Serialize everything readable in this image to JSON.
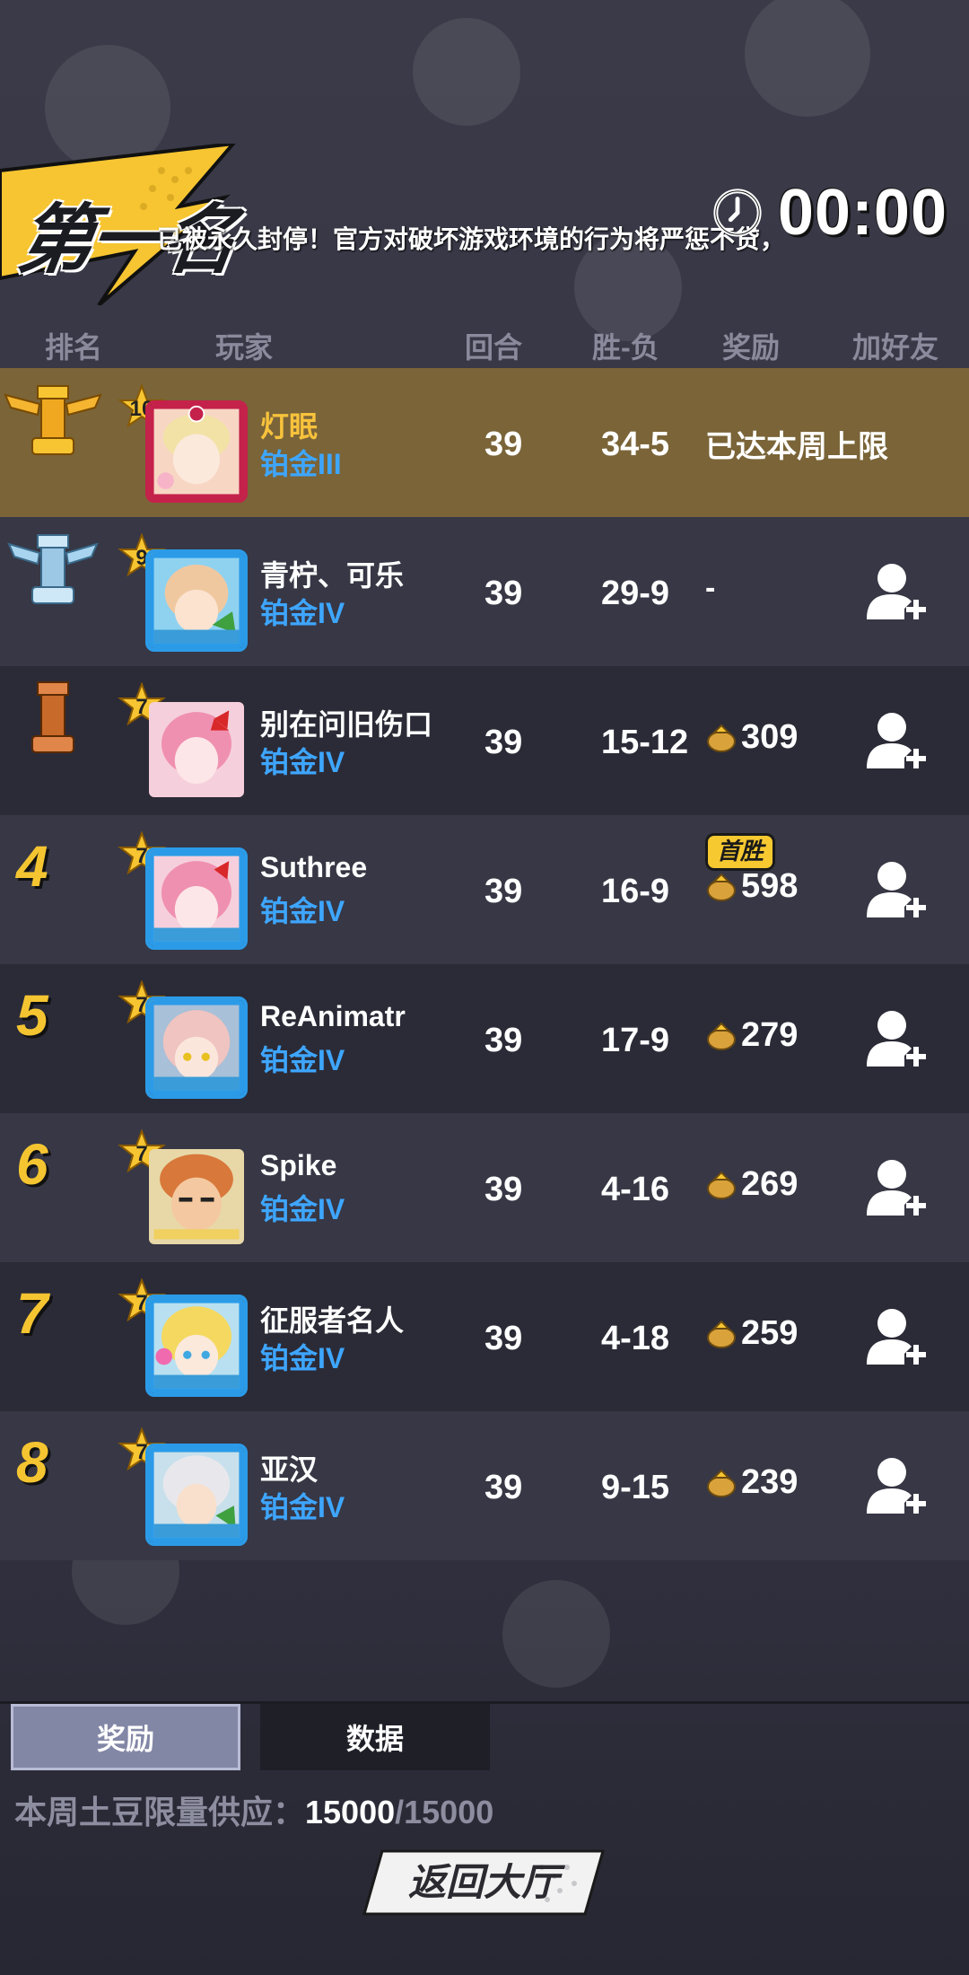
{
  "header": {
    "placement_title": "第一名",
    "notice": "已被永久封停！官方对破坏游戏环境的行为将严惩不贷，",
    "timer": "00:00"
  },
  "columns": {
    "rank": "排名",
    "player": "玩家",
    "rounds": "回合",
    "win_loss": "胜-负",
    "reward": "奖励",
    "add_friend": "加好友"
  },
  "rows": [
    {
      "rank": "1",
      "level": "10",
      "name": "灯眠",
      "tier": "铂金III",
      "rounds": "39",
      "wl": "34-5",
      "reward": "已达本周上限"
    },
    {
      "rank": "2",
      "level": "9",
      "name": "青柠、可乐",
      "tier": "铂金IV",
      "rounds": "39",
      "wl": "29-9",
      "reward": "-"
    },
    {
      "rank": "3",
      "level": "7",
      "name": "别在问旧伤口",
      "tier": "铂金IV",
      "rounds": "39",
      "wl": "15-12",
      "reward": "309"
    },
    {
      "rank": "4",
      "level": "7",
      "name": "Suthree",
      "tier": "铂金IV",
      "rounds": "39",
      "wl": "16-9",
      "reward": "598",
      "badge": "首胜"
    },
    {
      "rank": "5",
      "level": "7",
      "name": "ReAnimatr",
      "tier": "铂金IV",
      "rounds": "39",
      "wl": "17-9",
      "reward": "279"
    },
    {
      "rank": "6",
      "level": "7",
      "name": "Spike",
      "tier": "铂金IV",
      "rounds": "39",
      "wl": "4-16",
      "reward": "269"
    },
    {
      "rank": "7",
      "level": "7",
      "name": "征服者名人",
      "tier": "铂金IV",
      "rounds": "39",
      "wl": "4-18",
      "reward": "259"
    },
    {
      "rank": "8",
      "level": "7",
      "name": "亚汉",
      "tier": "铂金IV",
      "rounds": "39",
      "wl": "9-15",
      "reward": "239"
    }
  ],
  "tabs": {
    "reward": "奖励",
    "data": "数据"
  },
  "supply": {
    "label": "本周土豆限量供应：",
    "current": "15000",
    "max": "/15000"
  },
  "back_button": "返回大厅",
  "icons": {
    "rank1": "gold-rook-winged-icon",
    "rank2": "silver-rook-winged-icon",
    "rank3": "bronze-rook-icon",
    "reward": "potato-coin-icon",
    "add_friend": "add-friend-icon",
    "timer": "clock-icon"
  },
  "colors": {
    "gold_row": "#7a6438",
    "tier_blue": "#3ea6ff",
    "rank_yellow": "#f5c531"
  }
}
